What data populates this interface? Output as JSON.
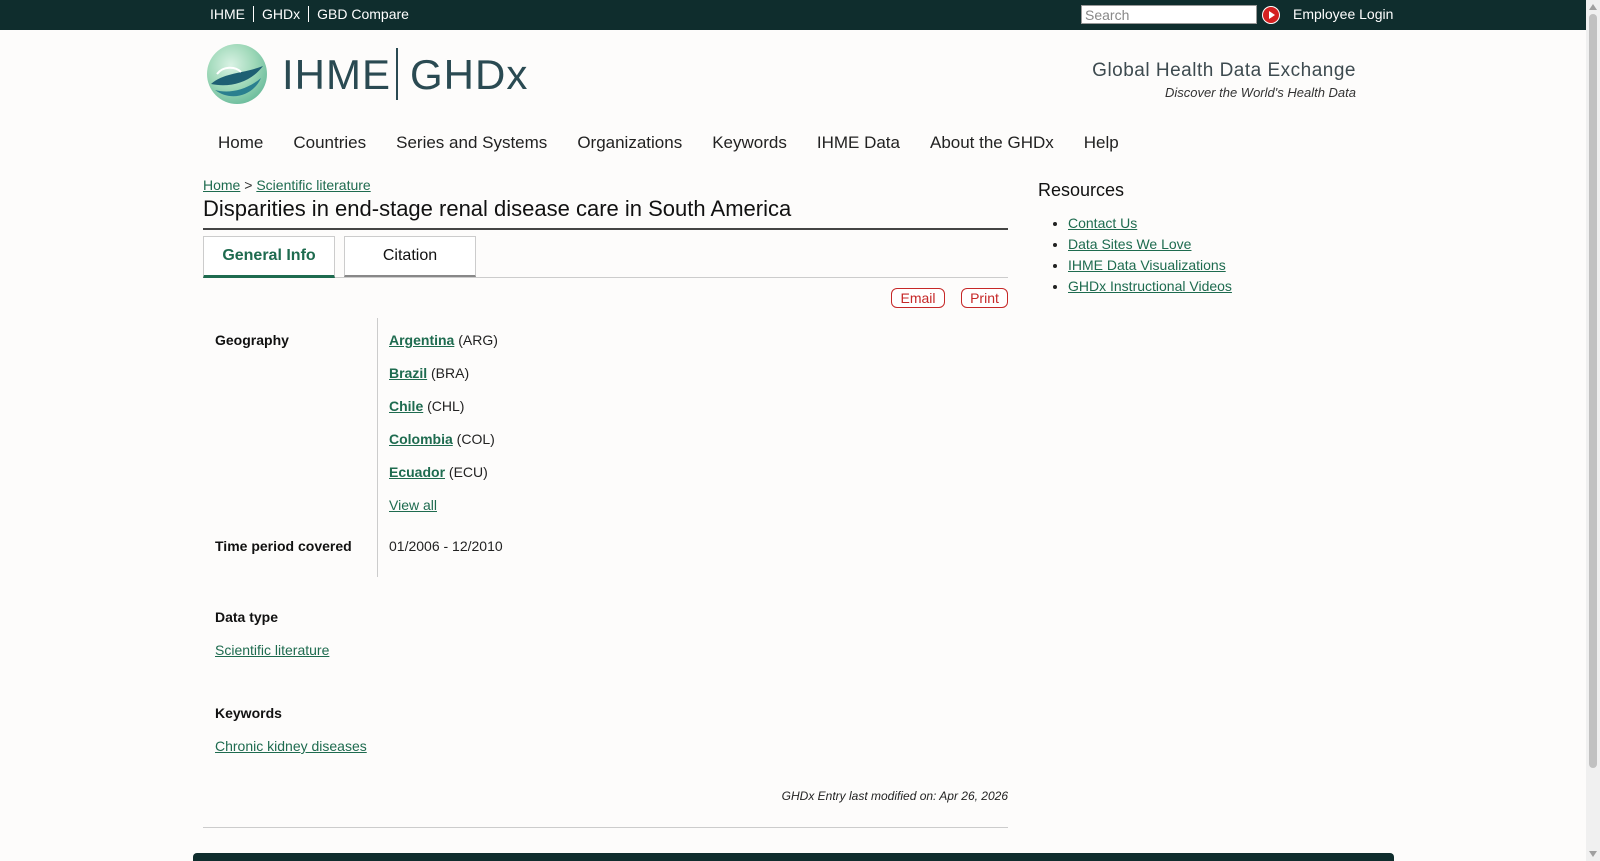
{
  "topbar": {
    "links": [
      "IHME",
      "GHDx",
      "GBD Compare"
    ],
    "search_placeholder": "Search",
    "employee_login": "Employee Login"
  },
  "header": {
    "logo_ihme": "IHME",
    "logo_ghdx": "GHDx",
    "tagline_title": "Global Health Data Exchange",
    "tagline_sub": "Discover the World's Health Data"
  },
  "nav": [
    "Home",
    "Countries",
    "Series and Systems",
    "Organizations",
    "Keywords",
    "IHME Data",
    "About the GHDx",
    "Help"
  ],
  "breadcrumb": {
    "home": "Home",
    "sep": ">",
    "section": "Scientific literature"
  },
  "page_title": "Disparities in end-stage renal disease care in South America",
  "tabs": [
    "General Info",
    "Citation"
  ],
  "actions": {
    "email": "Email",
    "print": "Print"
  },
  "info": {
    "geography_label": "Geography",
    "countries": [
      {
        "name": "Argentina",
        "code": "(ARG)"
      },
      {
        "name": "Brazil",
        "code": "(BRA)"
      },
      {
        "name": "Chile",
        "code": "(CHL)"
      },
      {
        "name": "Colombia",
        "code": "(COL)"
      },
      {
        "name": "Ecuador",
        "code": "(ECU)"
      }
    ],
    "view_all": "View all",
    "time_label": "Time period covered",
    "time_value": "01/2006 - 12/2010",
    "datatype_label": "Data type",
    "datatype_value": "Scientific literature",
    "keywords_label": "Keywords",
    "keywords_value": "Chronic kidney diseases"
  },
  "last_modified": "GHDx Entry last modified on: Apr 26, 2026",
  "resources": {
    "title": "Resources",
    "links": [
      "Contact Us",
      "Data Sites We Love",
      "IHME Data Visualizations",
      "GHDx Instructional Videos"
    ]
  },
  "colors": {
    "topbar": "#0f2d2d",
    "link": "#1e6b4f",
    "action": "#c62828"
  }
}
